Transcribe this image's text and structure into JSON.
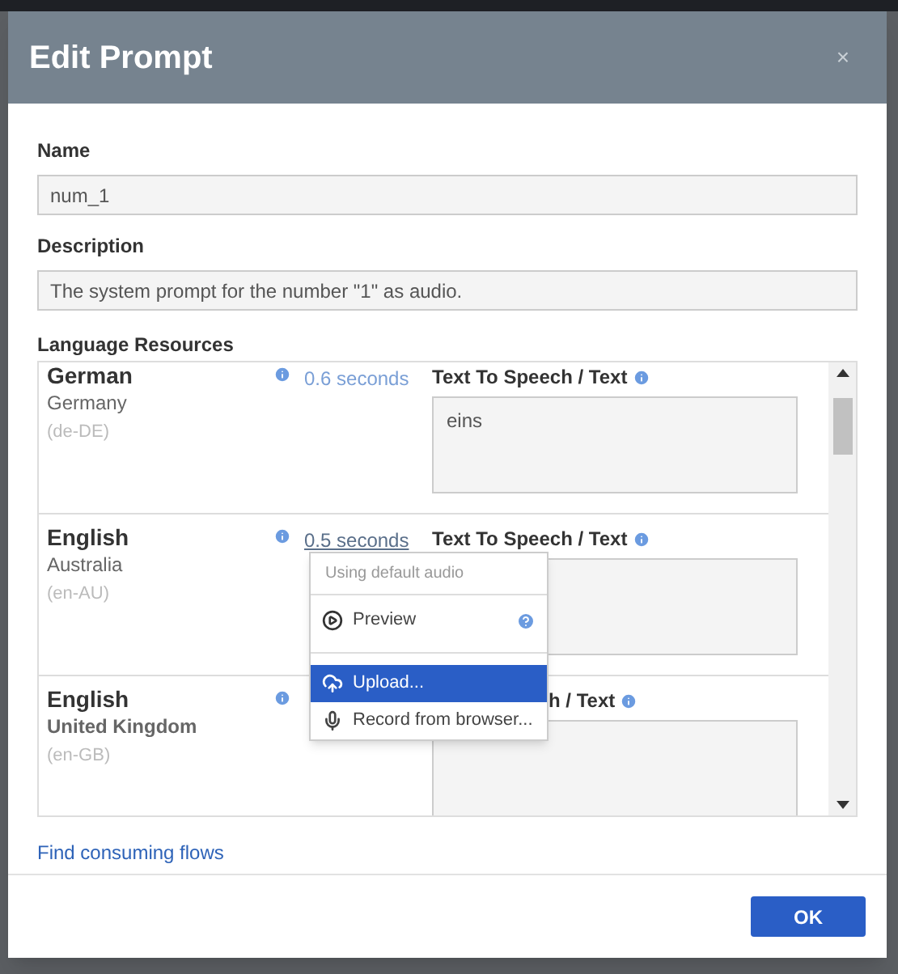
{
  "dialog": {
    "title": "Edit Prompt",
    "close": "×"
  },
  "name": {
    "label": "Name",
    "value": "num_1"
  },
  "description": {
    "label": "Description",
    "value": "The system prompt for the number \"1\" as audio."
  },
  "resources": {
    "label": "Language Resources",
    "rows": [
      {
        "language": "German",
        "region": "Germany",
        "code": "(de-DE)",
        "duration": "0.6 seconds",
        "duration_selected": false,
        "tts_label": "Text To Speech / Text",
        "tts_value": "eins"
      },
      {
        "language": "English",
        "region": "Australia",
        "code": "(en-AU)",
        "duration": "0.5 seconds",
        "duration_selected": true,
        "tts_label": "Text To Speech / Text",
        "tts_value": ""
      },
      {
        "language": "English",
        "region": "United Kingdom",
        "code": "(en-GB)",
        "tts_label": "h / Text",
        "tts_value": ""
      }
    ]
  },
  "menu": {
    "header": "Using default audio",
    "items": [
      {
        "label": "Preview",
        "kind": "preview",
        "selected": false
      },
      {
        "label": "Upload...",
        "kind": "upload",
        "selected": true
      },
      {
        "label": "Record from browser...",
        "kind": "record",
        "selected": false
      }
    ]
  },
  "link": "Find consuming flows",
  "ok_button": "OK"
}
